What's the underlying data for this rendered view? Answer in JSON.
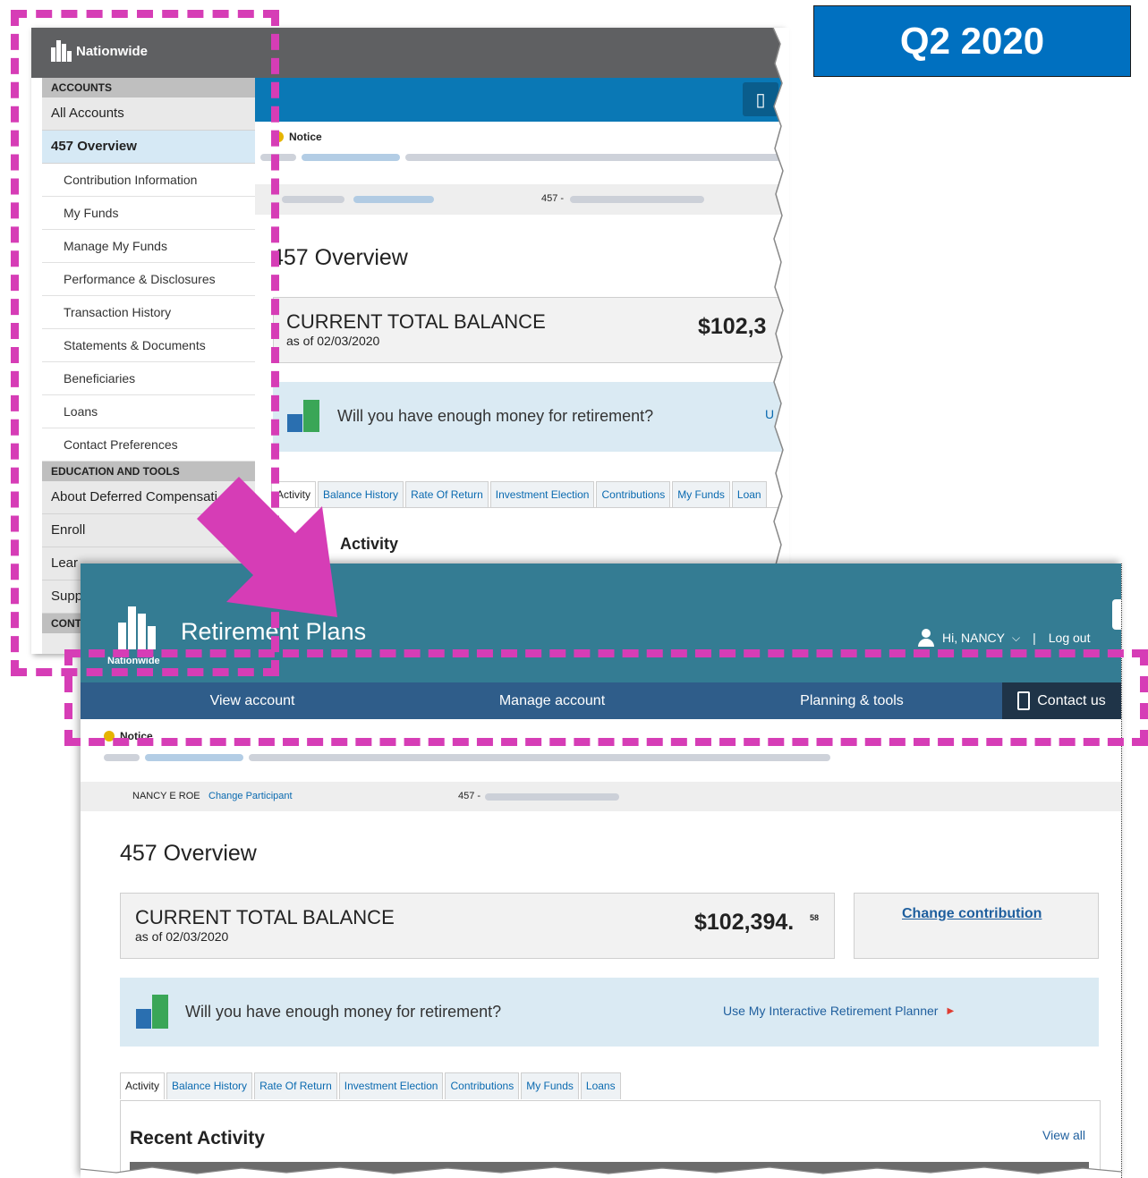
{
  "badge": {
    "label": "Q2 2020"
  },
  "old_screen": {
    "logo_text": "Nationwide",
    "sidebar": {
      "accounts_header": "ACCOUNTS",
      "all_accounts": "All Accounts",
      "overview": "457 Overview",
      "sub_items": [
        "Contribution Information",
        "My Funds",
        "Manage My Funds",
        "Performance & Disclosures",
        "Transaction History",
        "Statements & Documents",
        "Beneficiaries",
        "Loans",
        "Contact Preferences"
      ],
      "education_header": "EDUCATION AND TOOLS",
      "edu_items": [
        "About Deferred Compensati",
        "Enroll",
        "Lear",
        "Supp"
      ],
      "contact_header": "CONT"
    },
    "notice_label": "Notice",
    "plan_prefix": "457 -",
    "page_title": "457 Overview",
    "balance_title": "CURRENT TOTAL BALANCE",
    "balance_date": "as of 02/03/2020",
    "balance_amount": "$102,3",
    "retirement_question": "Will you have enough money for retirement?",
    "retirement_link_fragment": "U",
    "tabs": [
      "Activity",
      "Balance History",
      "Rate Of Return",
      "Investment Election",
      "Contributions",
      "My Funds",
      "Loan"
    ],
    "activity_heading": "Activity"
  },
  "new_screen": {
    "title": "Retirement Plans",
    "logo_text": "Nationwide",
    "greeting": "Hi, NANCY",
    "logout": "Log out",
    "nav": {
      "view_account": "View account",
      "manage_account": "Manage account",
      "planning_tools": "Planning & tools",
      "contact_us": "Contact us"
    },
    "notice_label": "Notice",
    "participant_name": "NANCY E ROE",
    "change_participant": "Change Participant",
    "plan_prefix": "457 -",
    "page_title": "457 Overview",
    "balance_title": "CURRENT TOTAL BALANCE",
    "balance_date": "as of 02/03/2020",
    "balance_dollars": "$102,394.",
    "balance_cents": "58",
    "change_contribution": "Change contribution",
    "retirement_question": "Will you have enough money for retirement?",
    "planner_link": "Use My Interactive Retirement Planner",
    "tabs": [
      "Activity",
      "Balance History",
      "Rate Of Return",
      "Investment Election",
      "Contributions",
      "My Funds",
      "Loans"
    ],
    "recent_activity": "Recent Activity",
    "view_all": "View all"
  },
  "colors": {
    "annotation": "#d63db6",
    "badge_bg": "#0070c0",
    "old_blue": "#0a78b5",
    "new_teal": "#347c93",
    "new_nav": "#2f5d8a"
  }
}
